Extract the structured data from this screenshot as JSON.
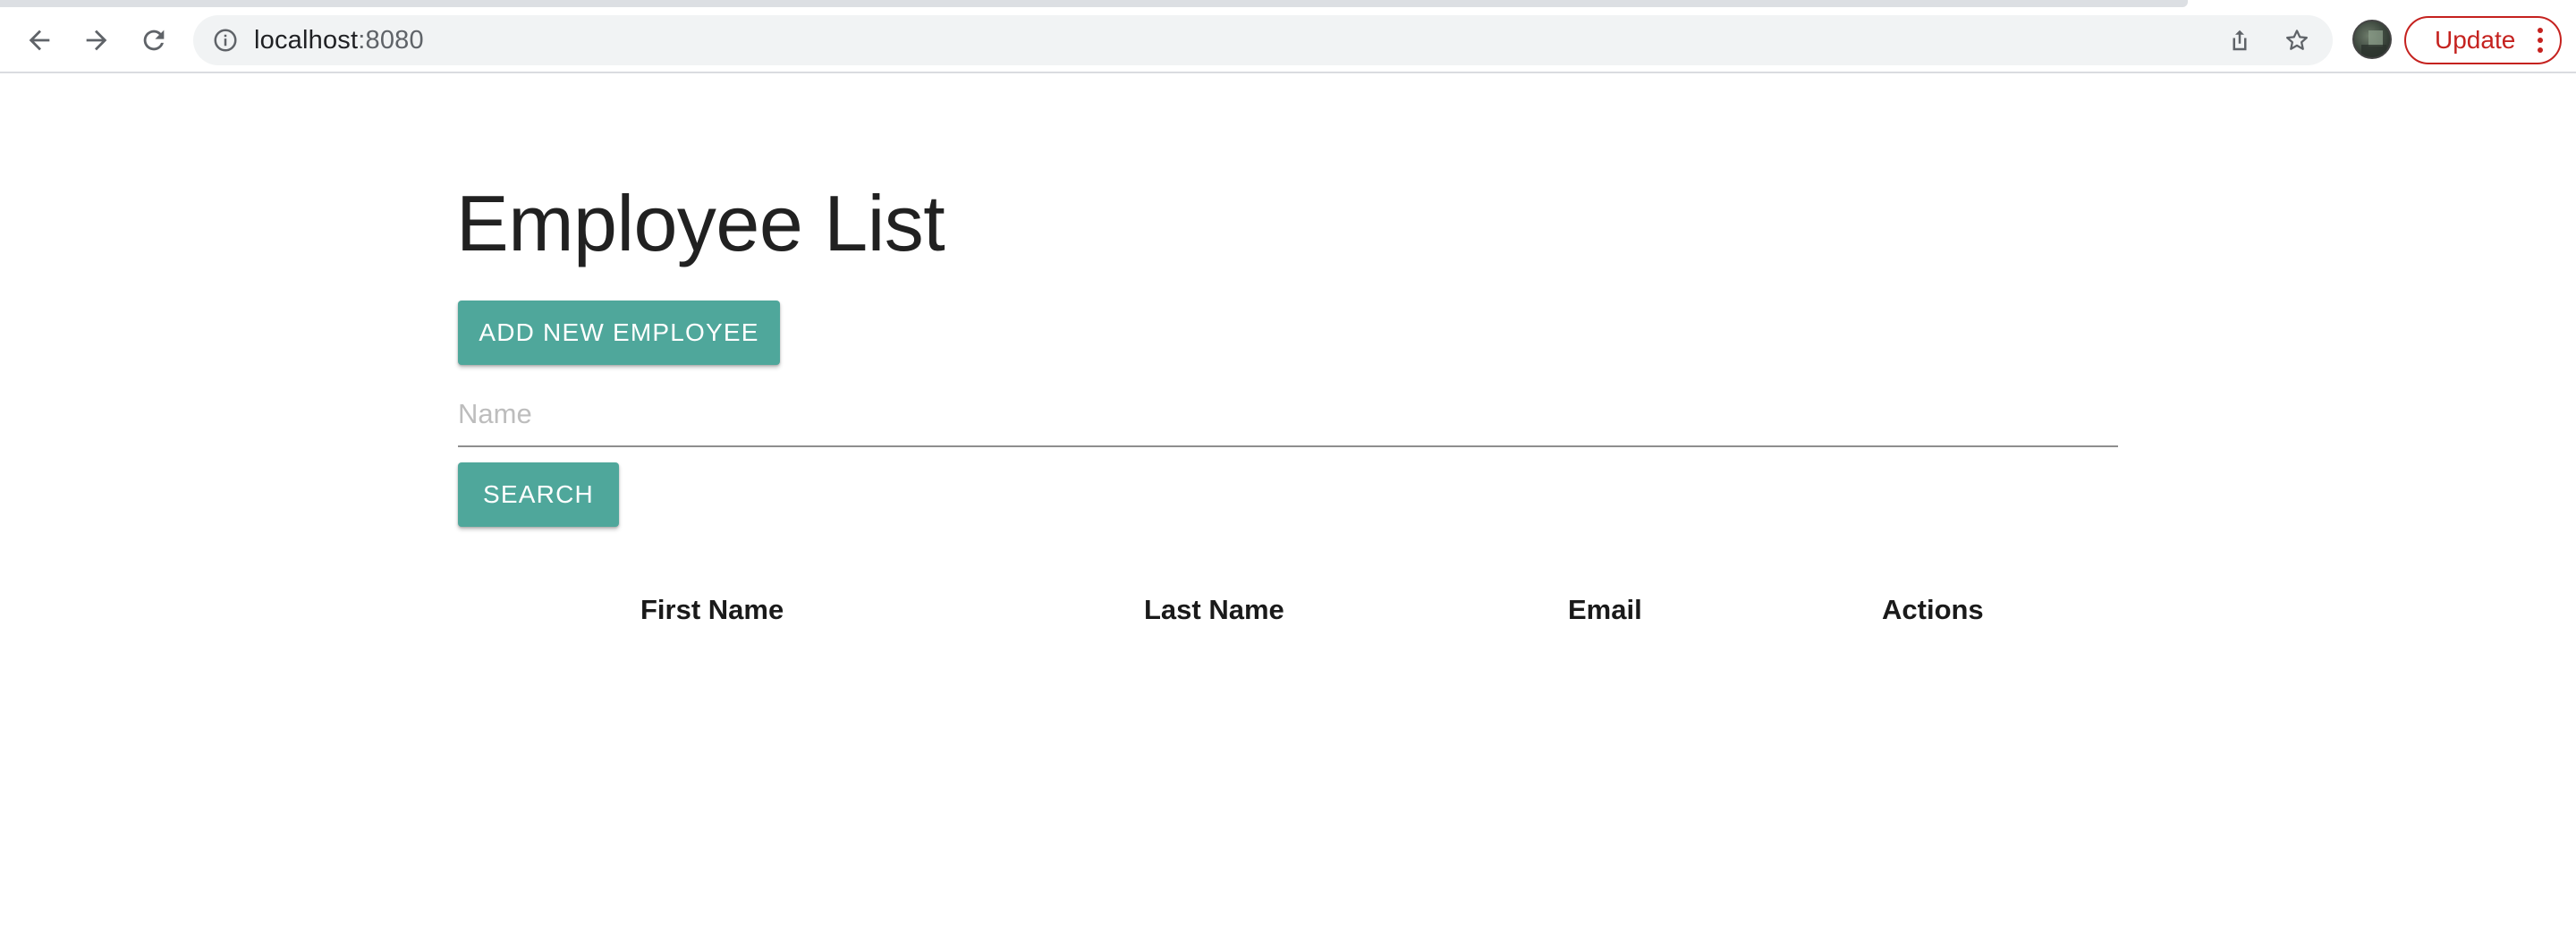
{
  "browser": {
    "url_host": "localhost",
    "url_port": ":8080",
    "update_label": "Update",
    "icons": [
      "back-arrow-icon",
      "forward-arrow-icon",
      "reload-icon",
      "info-icon",
      "share-icon",
      "star-icon",
      "kebab-menu-icon"
    ],
    "update_color": "#c5221f"
  },
  "page": {
    "title": "Employee List",
    "add_button_label": "ADD NEW EMPLOYEE",
    "search": {
      "placeholder": "Name",
      "value": "",
      "button_label": "SEARCH"
    },
    "table": {
      "columns": [
        "First Name",
        "Last Name",
        "Email",
        "Actions"
      ],
      "rows": []
    },
    "accent_color": "#4fa79b"
  }
}
